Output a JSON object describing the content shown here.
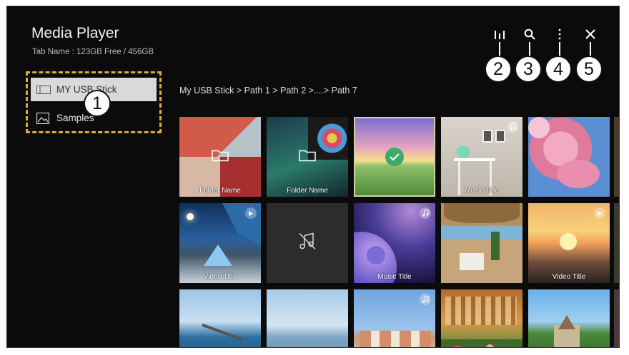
{
  "app": {
    "title": "Media Player",
    "subtitle": "Tab Name : 123GB Free / 456GB"
  },
  "toolbar": {
    "icons": [
      "equalizer-icon",
      "search-icon",
      "more-icon",
      "close-icon"
    ],
    "callouts": [
      "2",
      "3",
      "4",
      "5"
    ]
  },
  "sidebar": {
    "items": [
      {
        "label": "MY USB Stick",
        "icon": "usb-drive-icon",
        "selected": true
      },
      {
        "label": "Samples",
        "icon": "image-icon",
        "selected": false
      }
    ],
    "callout": "1"
  },
  "breadcrumb": {
    "text": "My USB Stick  >  Path 1  >  Path 2  >....>  Path 7"
  },
  "tiles": {
    "row1": [
      {
        "type": "folder",
        "label": "Folder Name"
      },
      {
        "type": "folder",
        "label": "Folder Name"
      },
      {
        "type": "image",
        "label": "",
        "checked": true
      },
      {
        "type": "music",
        "label": "Music Title"
      },
      {
        "type": "image",
        "label": ""
      }
    ],
    "row2": [
      {
        "type": "video",
        "label": "Video Title"
      },
      {
        "type": "music-missing",
        "label": ""
      },
      {
        "type": "music",
        "label": "Music Title"
      },
      {
        "type": "image",
        "label": ""
      },
      {
        "type": "video",
        "label": "Video Title"
      }
    ],
    "row3": [
      {
        "type": "image",
        "label": ""
      },
      {
        "type": "image",
        "label": ""
      },
      {
        "type": "music",
        "label": ""
      },
      {
        "type": "image",
        "label": ""
      },
      {
        "type": "image",
        "label": ""
      }
    ]
  },
  "colors": {
    "background": "#0b0b0b",
    "highlight_border": "#e0a93a",
    "selected_item": "#d9d9d9",
    "check_green": "#3cab6a"
  }
}
